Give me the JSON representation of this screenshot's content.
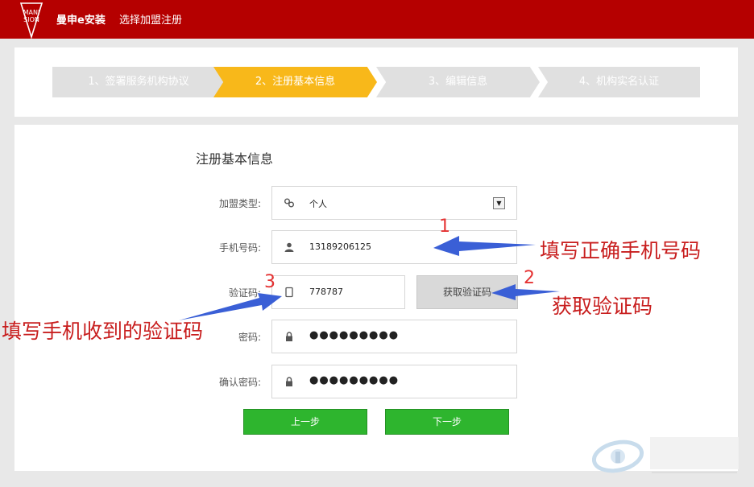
{
  "header": {
    "logo_text": "MANISION",
    "brand": "曼申e安装",
    "page_title": "选择加盟注册"
  },
  "steps": [
    {
      "label": "1、签署服务机构协议",
      "state": "todo"
    },
    {
      "label": "2、注册基本信息",
      "state": "active"
    },
    {
      "label": "3、编辑信息",
      "state": "todo"
    },
    {
      "label": "4、机构实名认证",
      "state": "todo"
    }
  ],
  "form": {
    "title": "注册基本信息",
    "join_type": {
      "label": "加盟类型:",
      "value": "个人",
      "icon": "link-icon"
    },
    "phone": {
      "label": "手机号码:",
      "value": "13189206125",
      "icon": "user-icon"
    },
    "code": {
      "label": "验证码:",
      "value": "778787",
      "icon": "phone-icon",
      "button": "获取验证码"
    },
    "password": {
      "label": "密码:",
      "value": "●●●●●●●●●",
      "icon": "lock-icon"
    },
    "confirm_password": {
      "label": "确认密码:",
      "value": "●●●●●●●●●",
      "icon": "lock-icon"
    },
    "prev_button": "上一步",
    "next_button": "下一步"
  },
  "annotations": [
    {
      "number": "1",
      "text": "填写正确手机号码"
    },
    {
      "number": "2",
      "text": "获取验证码"
    },
    {
      "number": "3",
      "text": "填写手机收到的验证码"
    }
  ],
  "colors": {
    "header": "#b50000",
    "step_active": "#f8b81a",
    "step_todo": "#e0e0e0",
    "button_green": "#2eb52e",
    "annotation_red": "#c81e1e",
    "arrow_blue": "#3a5fd6"
  }
}
